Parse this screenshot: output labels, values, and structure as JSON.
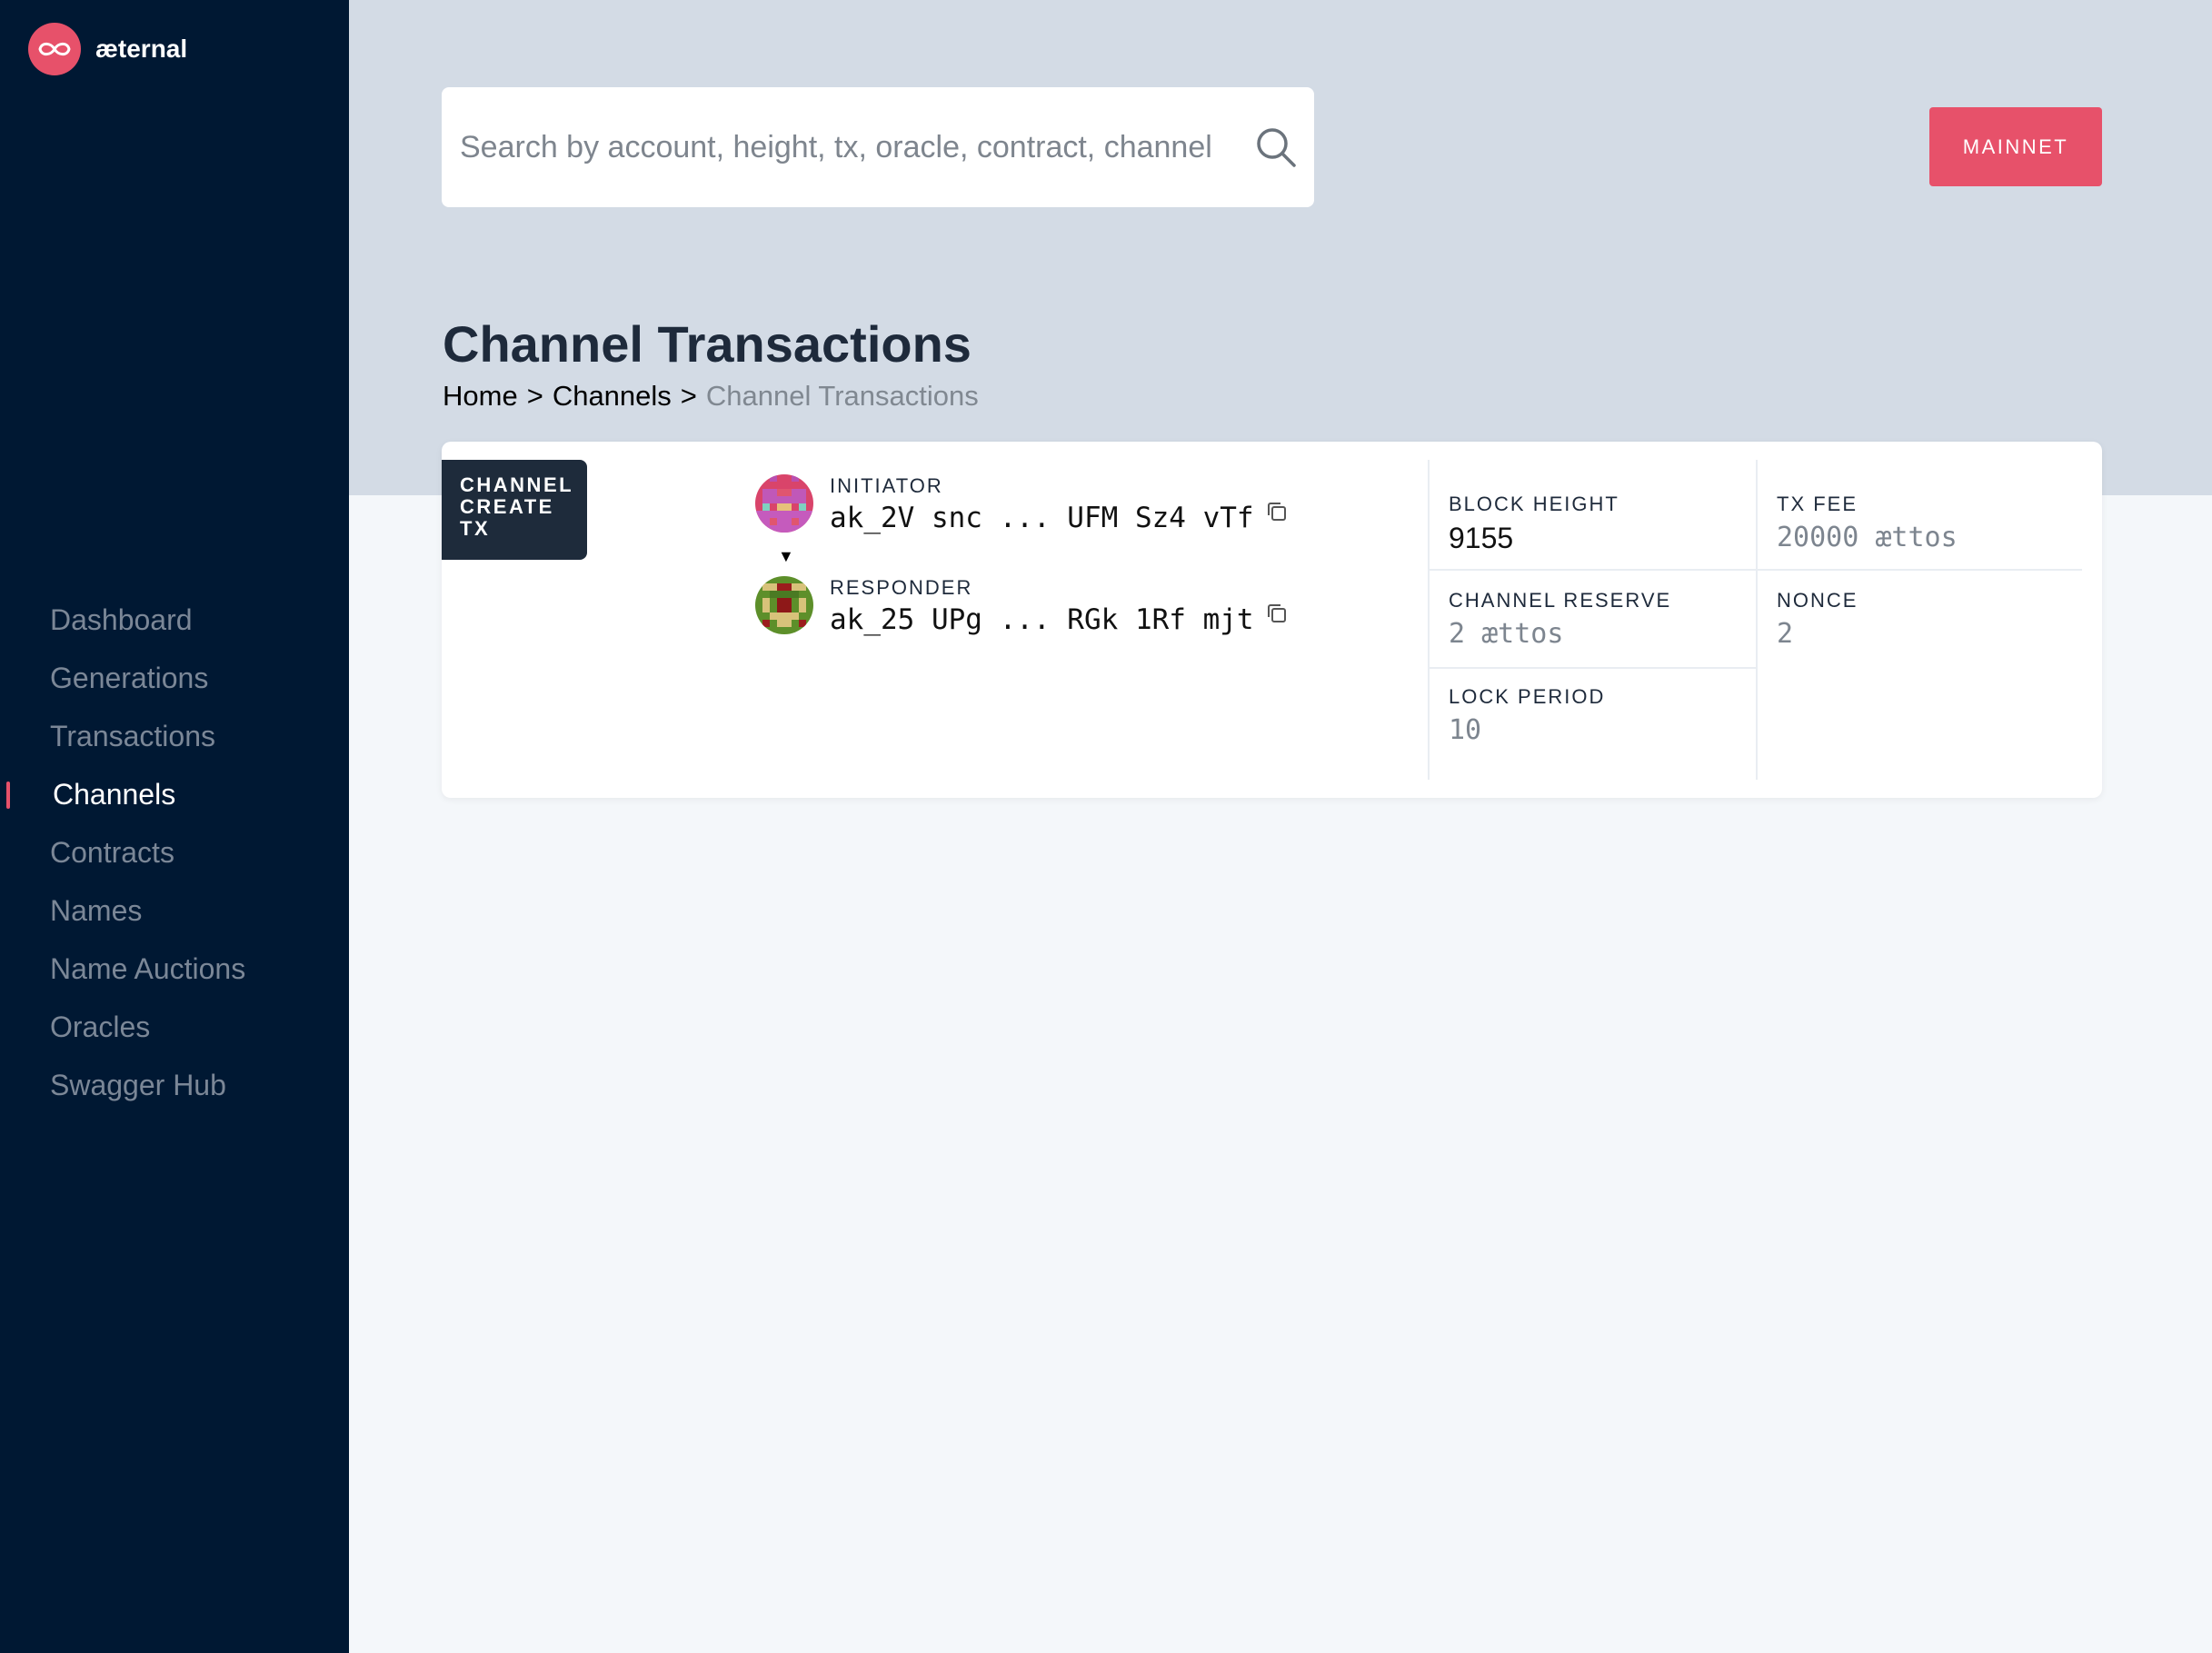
{
  "brand": {
    "name": "æternal",
    "logo_icon": "infinity-icon",
    "accent": "#e7516a"
  },
  "sidebar": {
    "items": [
      {
        "label": "Dashboard",
        "active": false
      },
      {
        "label": "Generations",
        "active": false
      },
      {
        "label": "Transactions",
        "active": false
      },
      {
        "label": "Channels",
        "active": true
      },
      {
        "label": "Contracts",
        "active": false
      },
      {
        "label": "Names",
        "active": false
      },
      {
        "label": "Name Auctions",
        "active": false
      },
      {
        "label": "Oracles",
        "active": false
      },
      {
        "label": "Swagger Hub",
        "active": false
      }
    ]
  },
  "search": {
    "placeholder": "Search by account, height, tx, oracle, contract, channel",
    "value": "",
    "icon": "search-icon"
  },
  "network": {
    "label": "MAINNET"
  },
  "page": {
    "title": "Channel Transactions",
    "breadcrumb": {
      "items": [
        "Home",
        "Channels"
      ],
      "separator": ">",
      "current": "Channel Transactions"
    }
  },
  "transaction": {
    "type_label": "CHANNEL CREATE TX",
    "initiator": {
      "role": "INITIATOR",
      "address": "ak_2V snc ... UFM Sz4 vTf"
    },
    "responder": {
      "role": "RESPONDER",
      "address": "ak_25 UPg ... RGk 1Rf mjt"
    },
    "flow_arrow": "▼",
    "stats": {
      "block_height": {
        "label": "BLOCK HEIGHT",
        "value": "9155"
      },
      "tx_fee": {
        "label": "TX FEE",
        "value": "20000 ættos"
      },
      "channel_reserve": {
        "label": "CHANNEL RESERVE",
        "value": "2 ættos"
      },
      "nonce": {
        "label": "NONCE",
        "value": "2"
      },
      "lock_period": {
        "label": "LOCK PERIOD",
        "value": "10"
      }
    }
  }
}
